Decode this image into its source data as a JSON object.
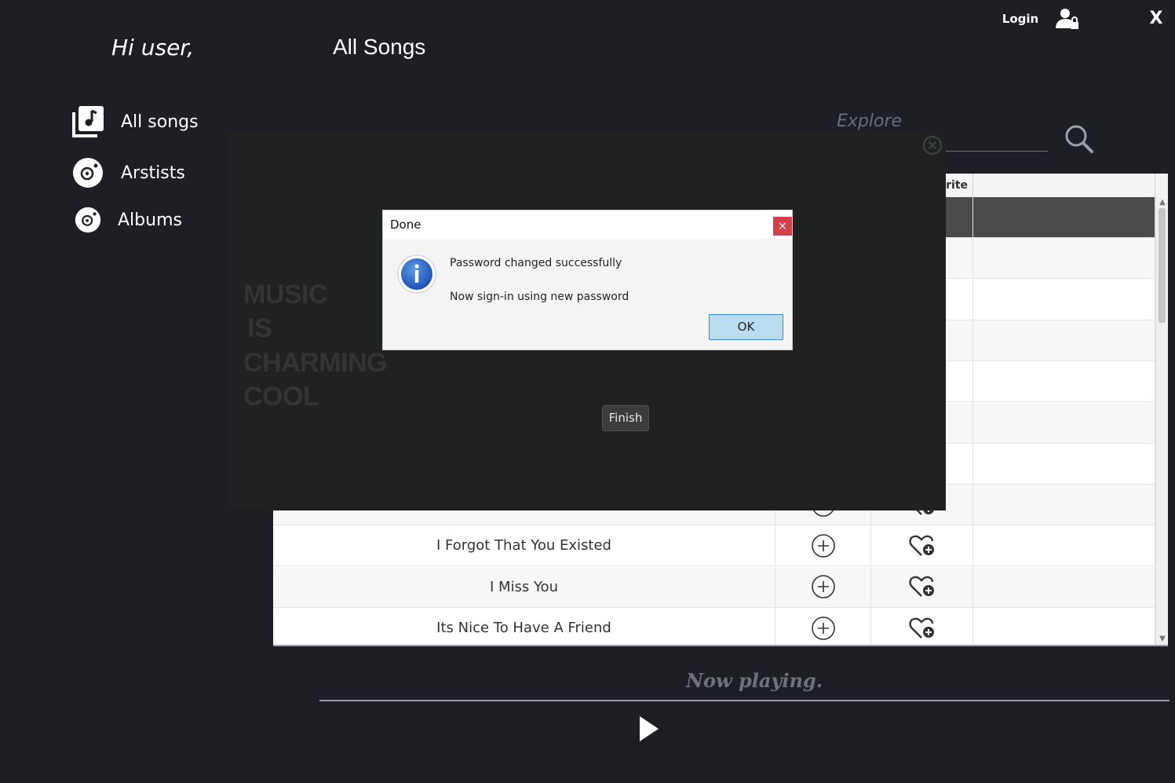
{
  "header": {
    "login_label": "Login",
    "close_label": "X"
  },
  "greeting": "Hi user,",
  "page_title": "All Songs",
  "sidebar": {
    "items": [
      {
        "label": "All songs",
        "icon": "music-library-icon"
      },
      {
        "label": "Arstists",
        "icon": "disc-icon"
      },
      {
        "label": "Albums",
        "icon": "disc-icon"
      }
    ]
  },
  "search": {
    "placeholder": "Explore"
  },
  "table": {
    "columns": [
      "",
      "",
      "rite",
      ""
    ],
    "rows": [
      {
        "title": ""
      },
      {
        "title": ""
      },
      {
        "title": ""
      },
      {
        "title": ""
      },
      {
        "title": ""
      },
      {
        "title": ""
      },
      {
        "title": ""
      },
      {
        "title": ""
      },
      {
        "title": "I Forgot That You Existed"
      },
      {
        "title": "I Miss You"
      },
      {
        "title": "Its Nice To Have A Friend"
      }
    ]
  },
  "overlay": {
    "slogan": [
      "MUSIC",
      "IS",
      "CHARMING",
      "COOL"
    ],
    "finish_label": "Finish"
  },
  "dialog": {
    "title": "Done",
    "close_label": "×",
    "message_1": "Password changed successfully",
    "message_2": "Now sign-in using new password",
    "ok_label": "OK"
  },
  "player": {
    "now_playing_label": "Now playing."
  },
  "colors": {
    "background": "#1d1f24",
    "overlay": "#202222",
    "dialog_close": "#d2404a",
    "ok_button": "#b9dcf0"
  }
}
